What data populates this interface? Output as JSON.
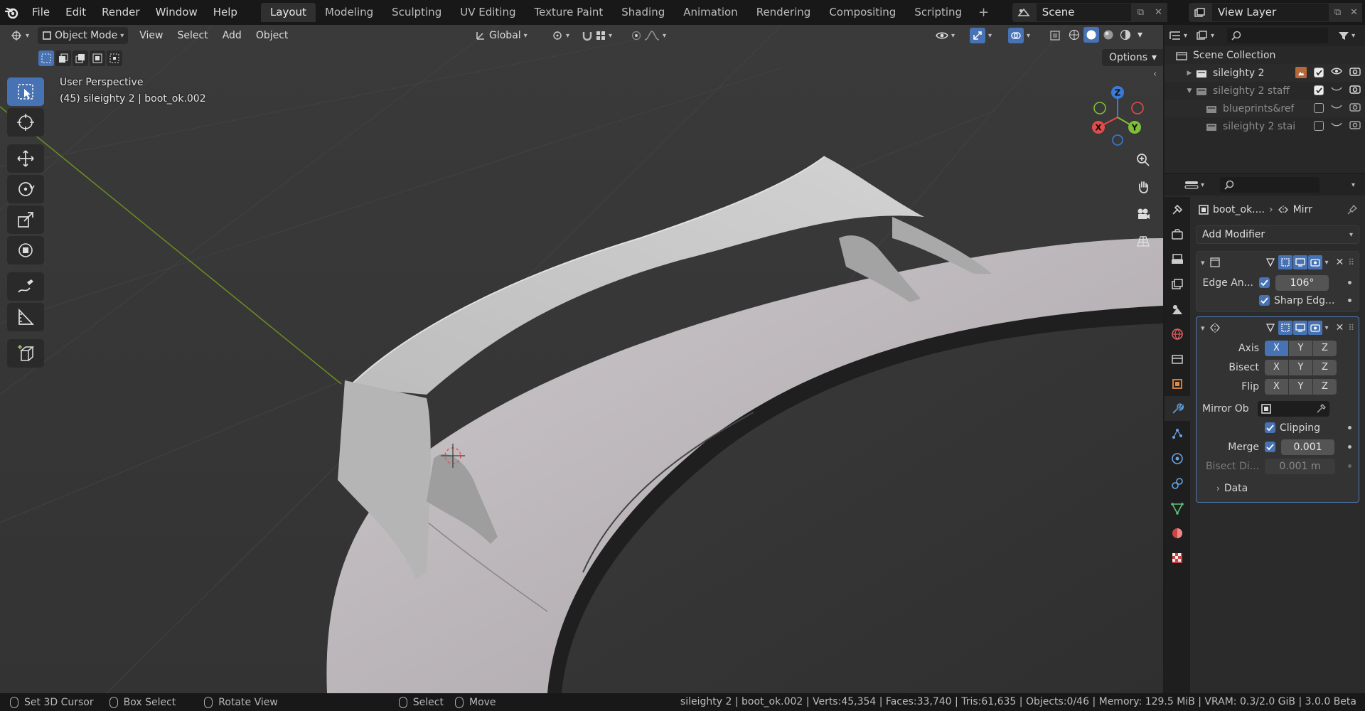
{
  "topbar": {
    "menus": [
      "File",
      "Edit",
      "Render",
      "Window",
      "Help"
    ],
    "workspaces": [
      "Layout",
      "Modeling",
      "Sculpting",
      "UV Editing",
      "Texture Paint",
      "Shading",
      "Animation",
      "Rendering",
      "Compositing",
      "Scripting"
    ],
    "active_workspace": "Layout",
    "scene": "Scene",
    "view_layer": "View Layer"
  },
  "viewport": {
    "mode": "Object Mode",
    "menus": [
      "View",
      "Select",
      "Add",
      "Object"
    ],
    "transform_orientation": "Global",
    "options_label": "Options",
    "info_line1": "User Perspective",
    "info_line2": "(45) sileighty 2 | boot_ok.002",
    "gizmo_axes": {
      "x": "X",
      "y": "Y",
      "z": "Z"
    }
  },
  "outliner": {
    "root": "Scene Collection",
    "items": [
      {
        "label": "sileighty 2",
        "level": 1,
        "dim": false
      },
      {
        "label": "sileighty 2 staff",
        "level": 1,
        "dim": true
      },
      {
        "label": "blueprints&ref",
        "level": 2,
        "dim": true
      },
      {
        "label": "sileighty 2 stai",
        "level": 2,
        "dim": true
      }
    ]
  },
  "properties": {
    "object_name": "boot_ok....",
    "modifier_name": "Mirr",
    "add_modifier": "Add Modifier",
    "edge_split": {
      "edge_angle_label": "Edge An...",
      "edge_angle_value": "106°",
      "sharp_edges_label": "Sharp Edg..."
    },
    "mirror": {
      "axis_label": "Axis",
      "bisect_label": "Bisect",
      "flip_label": "Flip",
      "axes": [
        "X",
        "Y",
        "Z"
      ],
      "axis_active": [
        true,
        false,
        false
      ],
      "mirror_object_label": "Mirror Ob",
      "clipping_label": "Clipping",
      "merge_label": "Merge",
      "merge_value": "0.001",
      "bisect_distance_label": "Bisect Di...",
      "bisect_distance_value": "0.001 m",
      "data_label": "Data"
    }
  },
  "statusbar": {
    "set_cursor": "Set 3D Cursor",
    "box_select": "Box Select",
    "rotate_view": "Rotate View",
    "select": "Select",
    "move": "Move",
    "stats": "sileighty 2 | boot_ok.002 | Verts:45,354 | Faces:33,740 | Tris:61,635 | Objects:0/46 | Memory: 129.5 MiB | VRAM: 0.3/2.0 GiB | 3.0.0 Beta"
  }
}
